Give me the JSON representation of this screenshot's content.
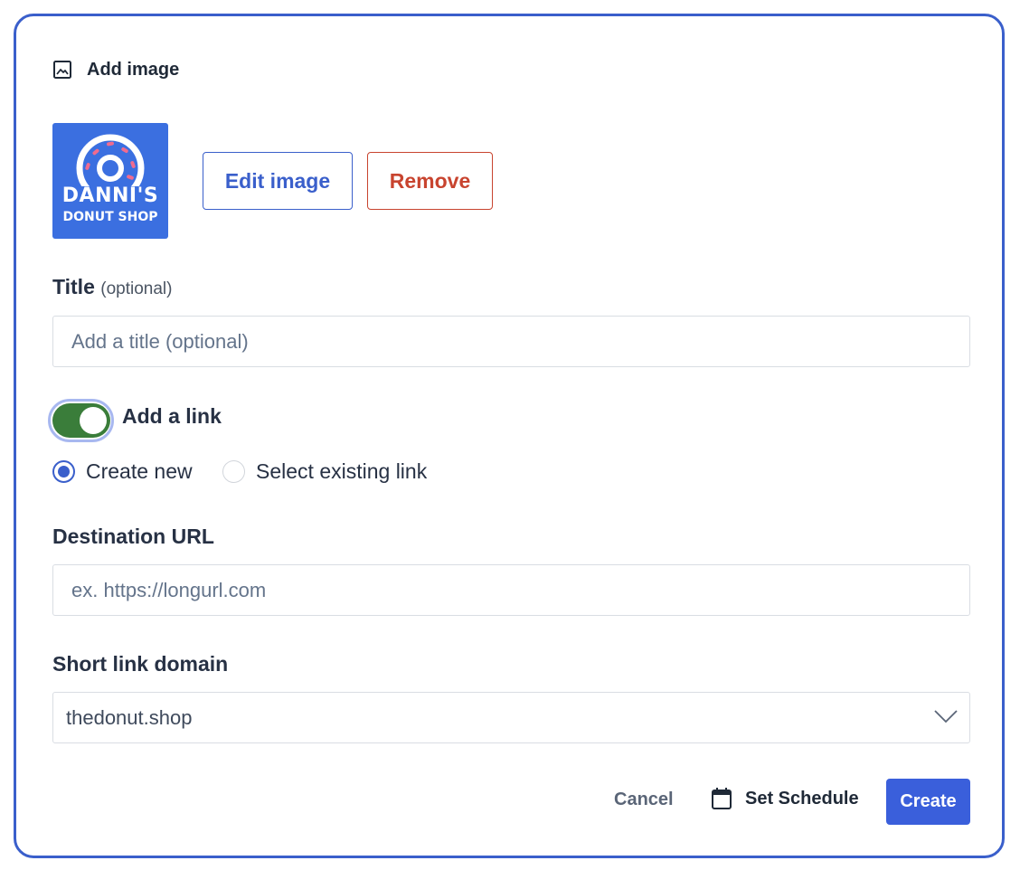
{
  "header": {
    "icon": "image-icon",
    "label": "Add image"
  },
  "image": {
    "logo_line1": "DANNI'S",
    "logo_line2": "DONUT SHOP",
    "background_color": "#3b6fe0",
    "edit_label": "Edit image",
    "remove_label": "Remove"
  },
  "title_field": {
    "label": "Title",
    "optional": "(optional)",
    "placeholder": "Add a title (optional)",
    "value": ""
  },
  "link_toggle": {
    "label": "Add a link",
    "enabled": true,
    "color": "#3a7d3a"
  },
  "link_mode": {
    "options": [
      "Create new",
      "Select existing link"
    ],
    "selected": "Create new"
  },
  "destination": {
    "label": "Destination URL",
    "placeholder": "ex. https://longurl.com",
    "value": ""
  },
  "domain": {
    "label": "Short link domain",
    "selected": "thedonut.shop"
  },
  "footer": {
    "cancel_label": "Cancel",
    "schedule_label": "Set Schedule",
    "create_label": "Create"
  },
  "colors": {
    "accent": "#3a5fcb",
    "danger": "#c8442f",
    "primary_button": "#3a5fdb"
  }
}
